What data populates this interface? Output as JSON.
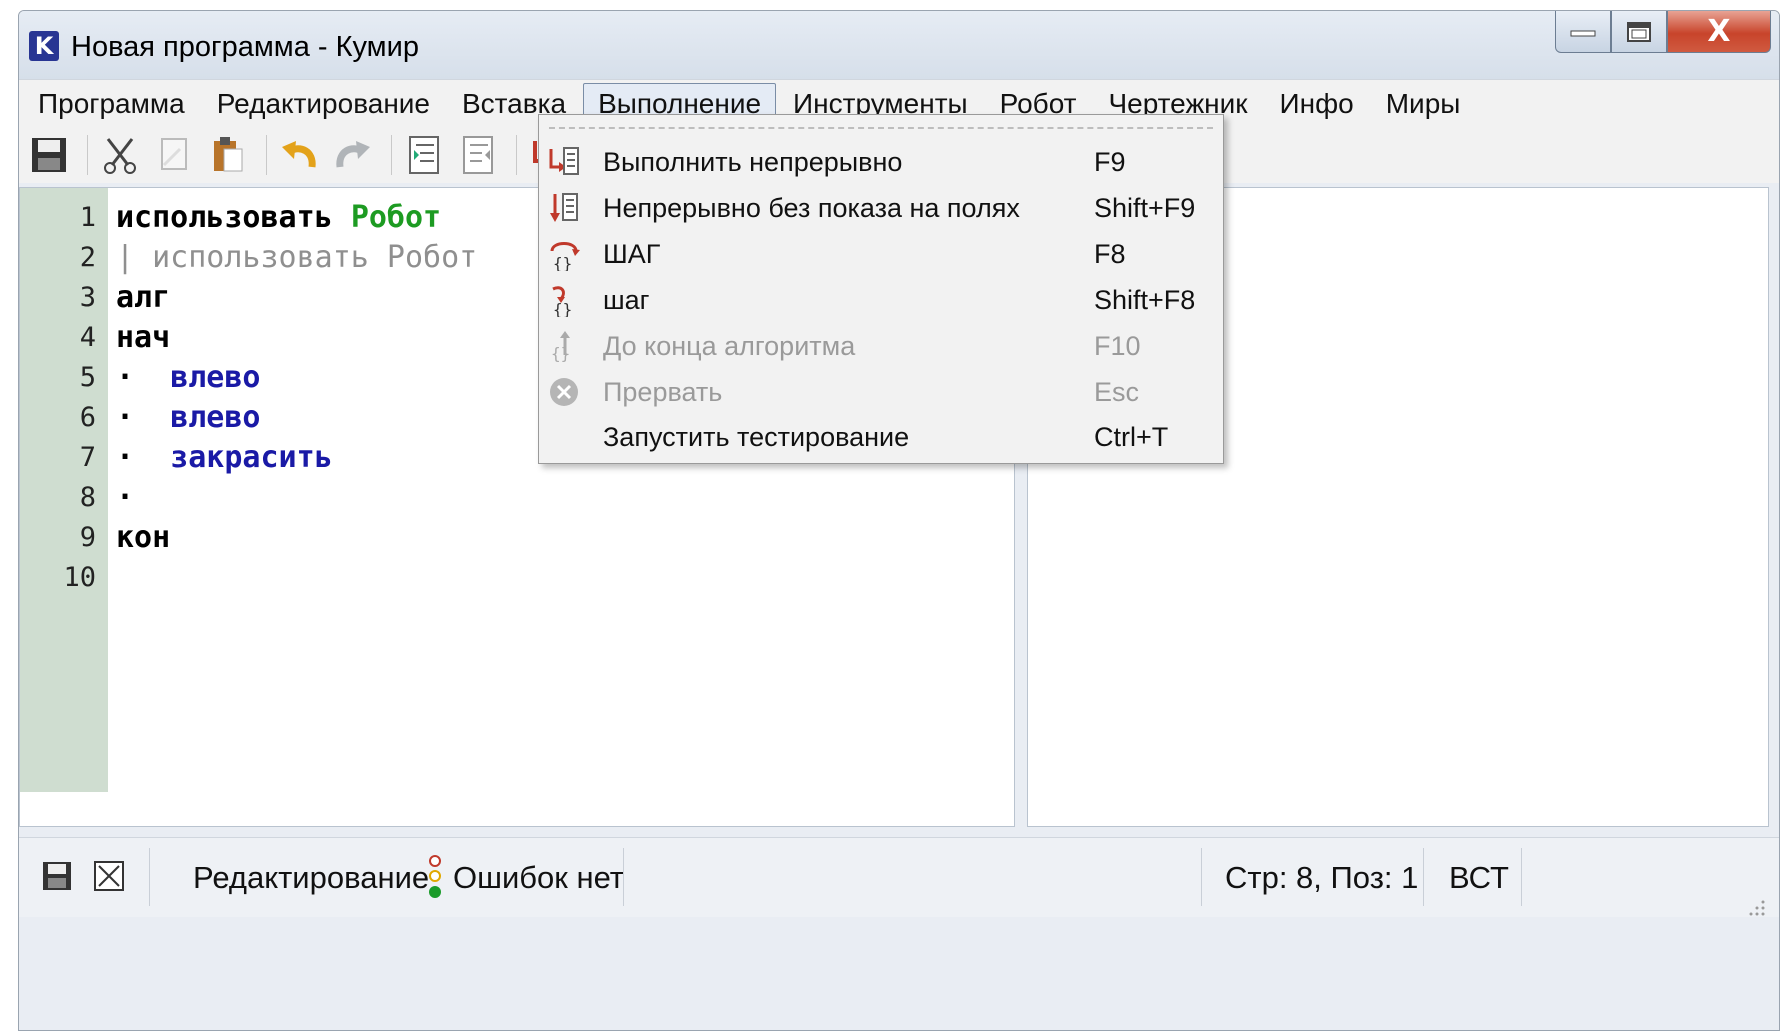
{
  "window": {
    "app_icon": "K",
    "title": "Новая программа - Кумир",
    "close_glyph": "X"
  },
  "menu": {
    "items": [
      "Программа",
      "Редактирование",
      "Вставка",
      "Выполнение",
      "Инструменты",
      "Робот",
      "Чертежник",
      "Инфо",
      "Миры"
    ],
    "active_index": 3
  },
  "toolbar": {
    "icons": [
      "save-icon",
      "cut-icon",
      "copy-icon",
      "paste-icon",
      "undo-icon",
      "redo-icon",
      "indent-icon",
      "unindent-icon",
      "run-icon"
    ]
  },
  "editor": {
    "line_numbers": [
      "1",
      "2",
      "3",
      "4",
      "5",
      "6",
      "7",
      "8",
      "9",
      "10"
    ],
    "lines": {
      "l1_kw": "использовать",
      "l1_mod": "Робот",
      "l2_ghost": "| использовать Робот",
      "l3_kw": "алг",
      "l4_kw": "нач",
      "l5_dot": "·",
      "l5_cmd": "влево",
      "l6_dot": "·",
      "l6_cmd": "влево",
      "l7_dot": "·",
      "l7_cmd": "закрасить",
      "l8_dot": "·",
      "l9_kw": "кон"
    }
  },
  "run_menu": {
    "items": [
      {
        "label": "Выполнить непрерывно",
        "shortcut": "F9",
        "enabled": true,
        "icon": "run-continuous-icon"
      },
      {
        "label": "Непрерывно без показа на полях",
        "shortcut": "Shift+F9",
        "enabled": true,
        "icon": "run-blind-icon"
      },
      {
        "label": "ШАГ",
        "shortcut": "F8",
        "enabled": true,
        "icon": "step-over-icon"
      },
      {
        "label": "шаг",
        "shortcut": "Shift+F8",
        "enabled": true,
        "icon": "step-into-icon"
      },
      {
        "label": "До конца алгоритма",
        "shortcut": "F10",
        "enabled": false,
        "icon": "step-out-icon"
      },
      {
        "label": "Прервать",
        "shortcut": "Esc",
        "enabled": false,
        "icon": "stop-icon"
      },
      {
        "label": "Запустить тестирование",
        "shortcut": "Ctrl+T",
        "enabled": true,
        "icon": ""
      }
    ]
  },
  "status": {
    "mode": "Редактирование",
    "errors": "Ошибок нет",
    "position": "Стр: 8, Поз: 1",
    "insert_mode": "ВСТ"
  },
  "colors": {
    "gutter": "#cfddd0",
    "keyword": "#000000",
    "module": "#1d9b22",
    "command": "#1a1aa6",
    "comment": "#8f8f8f"
  }
}
